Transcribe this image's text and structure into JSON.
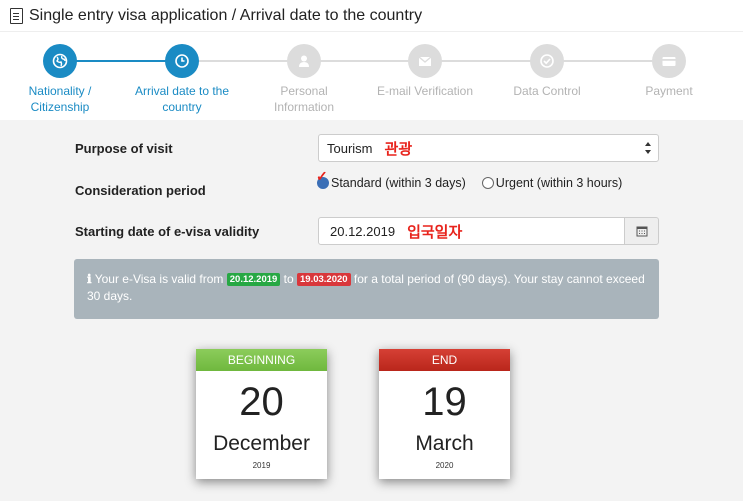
{
  "header": {
    "title": "Single entry visa application / Arrival date to the country"
  },
  "stepper": {
    "steps": [
      {
        "label": "Nationality /\nCitizenship",
        "state": "done",
        "icon": "globe-icon"
      },
      {
        "label": "Arrival date to the\ncountry",
        "state": "active",
        "icon": "clock-icon"
      },
      {
        "label": "Personal Information",
        "state": "inactive",
        "icon": "user-icon"
      },
      {
        "label": "E-mail Verification",
        "state": "inactive",
        "icon": "envelope-icon"
      },
      {
        "label": "Data Control",
        "state": "inactive",
        "icon": "check-circle-icon"
      },
      {
        "label": "Payment",
        "state": "inactive",
        "icon": "credit-card-icon"
      }
    ]
  },
  "form": {
    "purpose_label": "Purpose of visit",
    "purpose_value": "Tourism",
    "purpose_annotation": "관광",
    "consideration_label": "Consideration period",
    "option_standard": "Standard (within 3 days)",
    "option_urgent": "Urgent (within 3 hours)",
    "selected_option": "standard",
    "start_label": "Starting date of e-visa validity",
    "start_value": "20.12.2019",
    "start_annotation": "입국일자"
  },
  "info": {
    "prefix": "Your e-Visa is valid from",
    "from_date": "20.12.2019",
    "to_word": "to",
    "to_date": "19.03.2020",
    "suffix": "for a total period of (90 days). Your stay cannot exceed 30 days."
  },
  "cards": {
    "begin": {
      "header": "BEGINNING",
      "day": "20",
      "month": "December",
      "year": "2019"
    },
    "end": {
      "header": "END",
      "day": "19",
      "month": "March",
      "year": "2020"
    }
  },
  "colors": {
    "accent": "#1a8bc4",
    "inactive": "#dcdcdc",
    "annotation": "#e8231c",
    "badge_green": "#27a844",
    "badge_red": "#d9373b",
    "info_bg": "#a9b4bb"
  }
}
